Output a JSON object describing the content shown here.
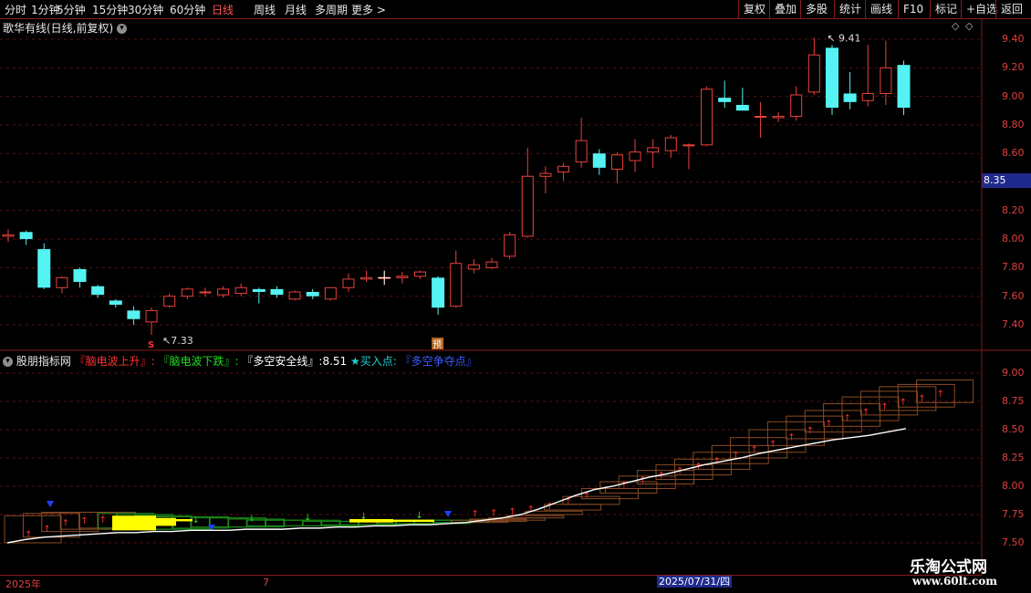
{
  "toolbar": {
    "left_items": [
      "分时",
      "1分钟",
      "5分钟",
      "15分钟",
      "30分钟",
      "60分钟",
      "日线",
      "周线",
      "月线",
      "多周期",
      "更多 >"
    ],
    "active": "日线",
    "right_items": [
      "复权",
      "叠加",
      "多股",
      "统计",
      "画线",
      "F10",
      "标记",
      "+自选",
      "返回"
    ]
  },
  "main_title": "歌华有线(日线,前复权)",
  "indicator": {
    "name": "股朋指标网",
    "up_label": "『脑电波上升』:",
    "down_label": "『脑电波下跌』:",
    "safe_label": "『多空安全线』:",
    "safe_value": "8.51",
    "buy_label": "★买入点:",
    "fight_label": "『多空争夺点』"
  },
  "price_axis": {
    "ticks": [
      "9.40",
      "9.20",
      "9.00",
      "8.80",
      "8.60",
      "8.20",
      "8.00",
      "7.80",
      "7.60",
      "7.40"
    ],
    "current": "8.35"
  },
  "ind_axis": {
    "ticks": [
      "9.00",
      "8.75",
      "8.50",
      "8.25",
      "8.00",
      "7.75",
      "7.50"
    ]
  },
  "annotations": {
    "high": "9.41",
    "low": "7.33",
    "s_mark": "S",
    "yu_mark": "预"
  },
  "dates": {
    "start": "2025年",
    "month": "7",
    "cursor": "2025/07/31/四"
  },
  "watermark": {
    "name": "乐淘公式网",
    "url": "www.60lt.com"
  },
  "colors": {
    "up": "#e8413c",
    "down": "#54f2f2",
    "safe_line": "#ffffff",
    "yellow": "#ffff00",
    "green": "#1a8a1a"
  },
  "chart_data": {
    "type": "candlestick",
    "price_range": [
      7.3,
      9.5
    ],
    "candles": [
      {
        "o": 8.02,
        "h": 8.07,
        "l": 7.98,
        "c": 8.03
      },
      {
        "o": 8.05,
        "h": 8.06,
        "l": 7.96,
        "c": 8.0
      },
      {
        "o": 7.93,
        "h": 7.97,
        "l": 7.65,
        "c": 7.66
      },
      {
        "o": 7.66,
        "h": 7.74,
        "l": 7.62,
        "c": 7.73
      },
      {
        "o": 7.79,
        "h": 7.8,
        "l": 7.66,
        "c": 7.7
      },
      {
        "o": 7.67,
        "h": 7.68,
        "l": 7.59,
        "c": 7.61
      },
      {
        "o": 7.57,
        "h": 7.58,
        "l": 7.52,
        "c": 7.54
      },
      {
        "o": 7.5,
        "h": 7.53,
        "l": 7.4,
        "c": 7.44
      },
      {
        "o": 7.42,
        "h": 7.52,
        "l": 7.33,
        "c": 7.5
      },
      {
        "o": 7.53,
        "h": 7.62,
        "l": 7.52,
        "c": 7.6
      },
      {
        "o": 7.6,
        "h": 7.66,
        "l": 7.58,
        "c": 7.65
      },
      {
        "o": 7.63,
        "h": 7.66,
        "l": 7.6,
        "c": 7.63
      },
      {
        "o": 7.61,
        "h": 7.67,
        "l": 7.59,
        "c": 7.65
      },
      {
        "o": 7.62,
        "h": 7.69,
        "l": 7.6,
        "c": 7.66
      },
      {
        "o": 7.65,
        "h": 7.66,
        "l": 7.55,
        "c": 7.63
      },
      {
        "o": 7.65,
        "h": 7.67,
        "l": 7.59,
        "c": 7.61
      },
      {
        "o": 7.58,
        "h": 7.64,
        "l": 7.57,
        "c": 7.63
      },
      {
        "o": 7.63,
        "h": 7.65,
        "l": 7.58,
        "c": 7.6
      },
      {
        "o": 7.58,
        "h": 7.66,
        "l": 7.57,
        "c": 7.66
      },
      {
        "o": 7.66,
        "h": 7.76,
        "l": 7.63,
        "c": 7.72
      },
      {
        "o": 7.72,
        "h": 7.78,
        "l": 7.7,
        "c": 7.73
      },
      {
        "o": 7.73,
        "h": 7.77,
        "l": 7.68,
        "c": 7.73
      },
      {
        "o": 7.73,
        "h": 7.77,
        "l": 7.69,
        "c": 7.74
      },
      {
        "o": 7.74,
        "h": 7.78,
        "l": 7.72,
        "c": 7.77
      },
      {
        "o": 7.73,
        "h": 7.74,
        "l": 7.47,
        "c": 7.52
      },
      {
        "o": 7.53,
        "h": 7.92,
        "l": 7.52,
        "c": 7.83
      },
      {
        "o": 7.79,
        "h": 7.86,
        "l": 7.76,
        "c": 7.82
      },
      {
        "o": 7.8,
        "h": 7.87,
        "l": 7.79,
        "c": 7.84
      },
      {
        "o": 7.88,
        "h": 8.05,
        "l": 7.86,
        "c": 8.03
      },
      {
        "o": 8.02,
        "h": 8.64,
        "l": 8.01,
        "c": 8.44
      },
      {
        "o": 8.44,
        "h": 8.51,
        "l": 8.32,
        "c": 8.46
      },
      {
        "o": 8.47,
        "h": 8.53,
        "l": 8.41,
        "c": 8.51
      },
      {
        "o": 8.54,
        "h": 8.85,
        "l": 8.5,
        "c": 8.69
      },
      {
        "o": 8.6,
        "h": 8.63,
        "l": 8.45,
        "c": 8.5
      },
      {
        "o": 8.49,
        "h": 8.61,
        "l": 8.39,
        "c": 8.59
      },
      {
        "o": 8.55,
        "h": 8.7,
        "l": 8.47,
        "c": 8.61
      },
      {
        "o": 8.61,
        "h": 8.7,
        "l": 8.5,
        "c": 8.64
      },
      {
        "o": 8.62,
        "h": 8.73,
        "l": 8.57,
        "c": 8.71
      },
      {
        "o": 8.66,
        "h": 8.67,
        "l": 8.49,
        "c": 8.66
      },
      {
        "o": 8.66,
        "h": 9.07,
        "l": 8.65,
        "c": 9.05
      },
      {
        "o": 8.99,
        "h": 9.11,
        "l": 8.92,
        "c": 8.96
      },
      {
        "o": 8.94,
        "h": 9.06,
        "l": 8.91,
        "c": 8.9
      },
      {
        "o": 8.86,
        "h": 8.96,
        "l": 8.71,
        "c": 8.86
      },
      {
        "o": 8.85,
        "h": 8.89,
        "l": 8.82,
        "c": 8.86
      },
      {
        "o": 8.86,
        "h": 9.07,
        "l": 8.83,
        "c": 9.01
      },
      {
        "o": 9.03,
        "h": 9.41,
        "l": 9.01,
        "c": 9.29
      },
      {
        "o": 9.34,
        "h": 9.36,
        "l": 8.87,
        "c": 8.92
      },
      {
        "o": 9.02,
        "h": 9.17,
        "l": 8.91,
        "c": 8.96
      },
      {
        "o": 8.97,
        "h": 9.36,
        "l": 8.93,
        "c": 9.02
      },
      {
        "o": 9.02,
        "h": 9.39,
        "l": 8.94,
        "c": 9.2
      },
      {
        "o": 9.22,
        "h": 9.25,
        "l": 8.87,
        "c": 8.92
      }
    ],
    "indicator_range": [
      7.5,
      9.05
    ],
    "safe_line": [
      7.5,
      7.53,
      7.55,
      7.56,
      7.57,
      7.58,
      7.59,
      7.59,
      7.6,
      7.6,
      7.61,
      7.61,
      7.61,
      7.62,
      7.62,
      7.62,
      7.63,
      7.63,
      7.64,
      7.64,
      7.65,
      7.65,
      7.66,
      7.66,
      7.67,
      7.68,
      7.7,
      7.72,
      7.75,
      7.8,
      7.86,
      7.92,
      7.97,
      8.0,
      8.04,
      8.08,
      8.11,
      8.15,
      8.19,
      8.22,
      8.25,
      8.29,
      8.32,
      8.35,
      8.38,
      8.41,
      8.43,
      8.45,
      8.48,
      8.51
    ]
  }
}
